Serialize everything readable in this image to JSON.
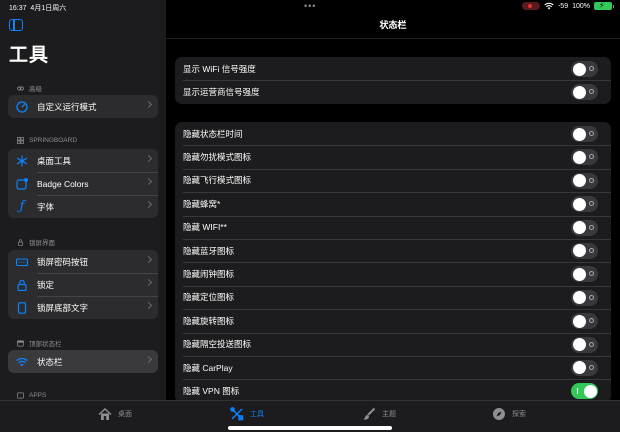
{
  "status_bar": {
    "time": "16:37",
    "date": "4月1日周六",
    "signal": "-59",
    "battery": "100%",
    "battery_color": "#34c759"
  },
  "sidebar": {
    "title": "工具",
    "sections": [
      {
        "header": "高级",
        "header_icon": "link-icon",
        "items": [
          {
            "label": "自定义运行模式",
            "icon": "gauge-icon"
          }
        ]
      },
      {
        "header": "SPRINGBOARD",
        "header_icon": "grid-icon",
        "items": [
          {
            "label": "桌面工具",
            "icon": "snowflake-icon"
          },
          {
            "label": "Badge Colors",
            "icon": "app-badge-icon"
          },
          {
            "label": "字体",
            "icon": "function-icon"
          }
        ]
      },
      {
        "header": "锁屏界面",
        "header_icon": "lock-small-icon",
        "items": [
          {
            "label": "锁屏密码按钮",
            "icon": "keyboard-icon"
          },
          {
            "label": "锁定",
            "icon": "lock-icon"
          },
          {
            "label": "锁屏底部文字",
            "icon": "ipad-icon"
          }
        ]
      },
      {
        "header": "顶部状态栏",
        "header_icon": "statusbar-small-icon",
        "items": [
          {
            "label": "状态栏",
            "icon": "wifi-icon",
            "selected": true
          }
        ]
      },
      {
        "header": "APPS",
        "header_icon": "apps-small-icon",
        "items": []
      }
    ]
  },
  "main": {
    "title": "状态栏",
    "group1": [
      {
        "label": "显示 WiFi 信号强度",
        "on": false
      },
      {
        "label": "显示运营商信号强度",
        "on": false
      }
    ],
    "group2": [
      {
        "label": "隐藏状态栏时间",
        "on": false
      },
      {
        "label": "隐藏勿扰模式图标",
        "on": false
      },
      {
        "label": "隐藏飞行模式图标",
        "on": false
      },
      {
        "label": "隐藏蜂窝*",
        "on": false
      },
      {
        "label": "隐藏 WIFI**",
        "on": false
      },
      {
        "label": "隐藏蓝牙图标",
        "on": false
      },
      {
        "label": "隐藏闹钟图标",
        "on": false
      },
      {
        "label": "隐藏定位图标",
        "on": false
      },
      {
        "label": "隐藏旋转图标",
        "on": false
      },
      {
        "label": "隐藏隔空投送图标",
        "on": false
      },
      {
        "label": "隐藏 CarPlay",
        "on": false
      },
      {
        "label": "隐藏 VPN 图标",
        "on": true
      }
    ]
  },
  "tabbar": {
    "tabs": [
      {
        "label": "桌面",
        "icon": "house-icon",
        "active": false
      },
      {
        "label": "工具",
        "icon": "tools-icon",
        "active": true
      },
      {
        "label": "主题",
        "icon": "paintbrush-icon",
        "active": false
      },
      {
        "label": "探索",
        "icon": "compass-icon",
        "active": false
      }
    ]
  },
  "colors": {
    "accent": "#0a84ff",
    "toggle_on": "#34c759",
    "toggle_off": "#39393d"
  }
}
